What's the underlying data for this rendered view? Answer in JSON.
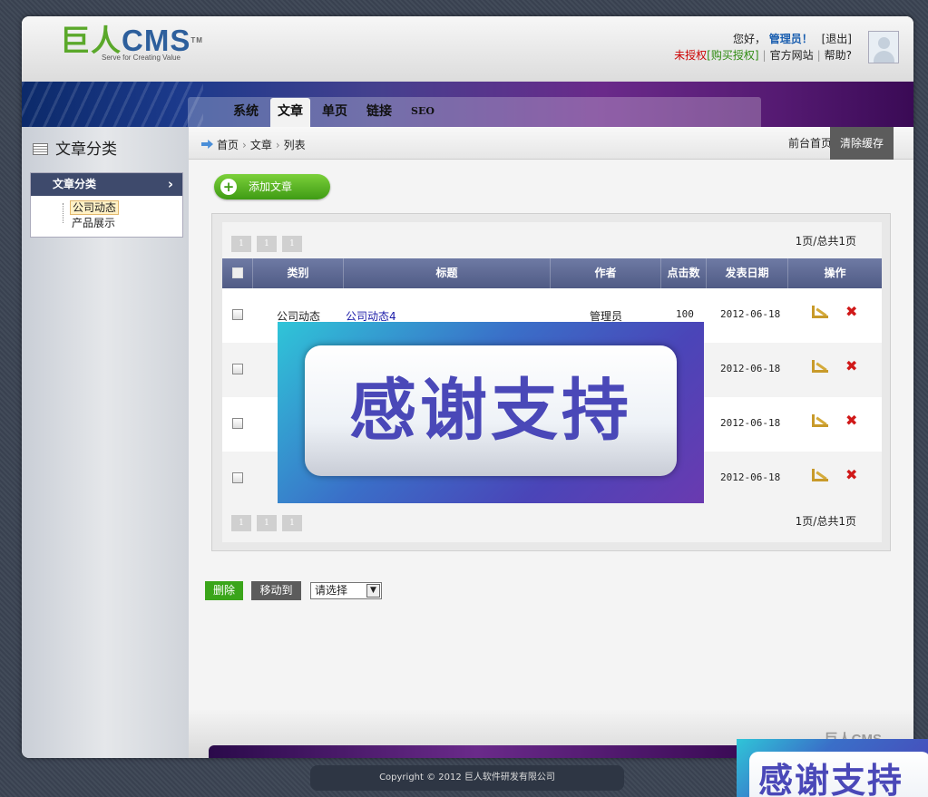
{
  "logo": {
    "part1": "巨人",
    "part2": "CMS",
    "tm": "TM",
    "tagline": "Serve for Creating Value"
  },
  "header": {
    "greeting": "您好，",
    "username": "管理员！",
    "logout": "[退出]",
    "unauthorized": "未授权",
    "buy_license": "[购买授权]",
    "official_site": "官方网站",
    "help": "帮助?"
  },
  "nav": {
    "tabs": [
      "系统",
      "文章",
      "单页",
      "链接",
      "SEO"
    ],
    "active_index": 1
  },
  "sidebar": {
    "title": "文章分类",
    "box_title": "文章分类",
    "items": [
      {
        "label": "公司动态",
        "active": true
      },
      {
        "label": "产品展示",
        "active": false
      }
    ]
  },
  "breadcrumb": {
    "home": "首页",
    "section": "文章",
    "page": "列表"
  },
  "topbar": {
    "front_page": "前台首页",
    "clear_cache": "清除缓存"
  },
  "add_button": "添加文章",
  "pager": {
    "pages": [
      "1",
      "1",
      "1"
    ],
    "info": "1页/总共1页"
  },
  "table": {
    "headers": {
      "category": "类别",
      "title": "标题",
      "author": "作者",
      "clicks": "点击数",
      "date": "发表日期",
      "actions": "操作"
    },
    "rows": [
      {
        "category": "公司动态",
        "title": "公司动态4",
        "author": "管理员",
        "clicks": "100",
        "date": "2012-06-18"
      },
      {
        "category": "",
        "title": "",
        "author": "",
        "clicks": "",
        "date": "2012-06-18"
      },
      {
        "category": "",
        "title": "",
        "author": "",
        "clicks": "",
        "date": "2012-06-18"
      },
      {
        "category": "",
        "title": "",
        "author": "",
        "clicks": "",
        "date": "2012-06-18"
      }
    ]
  },
  "bulk_actions": {
    "delete": "删除",
    "move_to": "移动到",
    "select_value": "请选择"
  },
  "footer": {
    "logo": "巨人CMS",
    "copyright": "Copyright © 2012 巨人软件研发有限公司"
  },
  "overlay": {
    "text": "感谢支持"
  },
  "colors": {
    "accent_green": "#3aa51a",
    "header_blue": "#505b85",
    "link_blue": "#1a1aa8",
    "delete_red": "#d01818"
  }
}
